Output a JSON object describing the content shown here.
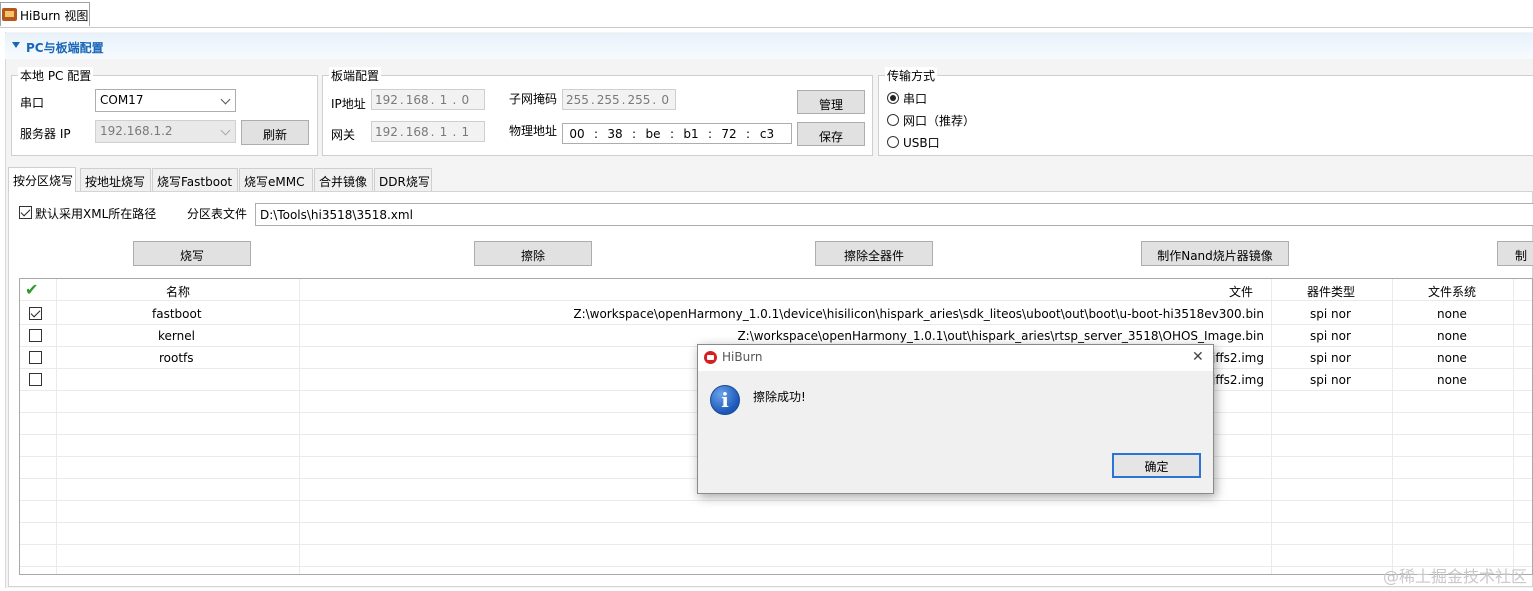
{
  "view_tab": {
    "label": "HiBurn 视图"
  },
  "section": {
    "title": "PC与板端配置"
  },
  "local_pc": {
    "title": "本地 PC 配置",
    "serial_label": "串口",
    "serial_value": "COM17",
    "server_ip_label": "服务器 IP",
    "server_ip_value": "192.168.1.2",
    "refresh_button": "刷新"
  },
  "board": {
    "title": "板端配置",
    "ip_label": "IP地址",
    "ip_value": [
      "192",
      "168",
      "1",
      "0"
    ],
    "gateway_label": "网关",
    "gateway_value": [
      "192",
      "168",
      "1",
      "1"
    ],
    "mask_label": "子网掩码",
    "mask_value": [
      "255",
      "255",
      "255",
      "0"
    ],
    "mac_label": "物理地址",
    "mac_value": [
      "00",
      "38",
      "be",
      "b1",
      "72",
      "c3"
    ],
    "manage_button": "管理",
    "save_button": "保存"
  },
  "transfer": {
    "title": "传输方式",
    "options": [
      {
        "label": "串口",
        "selected": true
      },
      {
        "label": "网口（推荐）",
        "selected": false
      },
      {
        "label": "USB口",
        "selected": false
      }
    ]
  },
  "tabs": [
    "按分区烧写",
    "按地址烧写",
    "烧写Fastboot",
    "烧写eMMC",
    "合并镜像",
    "DDR烧写"
  ],
  "partition": {
    "default_xml_label": "默认采用XML所在路径",
    "default_xml_checked": true,
    "table_file_label": "分区表文件",
    "table_file_value": "D:\\Tools\\hi3518\\3518.xml"
  },
  "actions": [
    "烧写",
    "擦除",
    "擦除全器件",
    "制作Nand烧片器镜像",
    "制作"
  ],
  "table": {
    "headers": {
      "check": "✔",
      "name": "名称",
      "file": "文件",
      "device_type": "器件类型",
      "fs": "文件系统"
    },
    "rows": [
      {
        "checked": true,
        "name": "fastboot",
        "file": "Z:\\workspace\\openHarmony_1.0.1\\device\\hisilicon\\hispark_aries\\sdk_liteos\\uboot\\out\\boot\\u-boot-hi3518ev300.bin",
        "device_type": "spi nor",
        "fs": "none"
      },
      {
        "checked": false,
        "name": "kernel",
        "file": "Z:\\workspace\\openHarmony_1.0.1\\out\\hispark_aries\\rtsp_server_3518\\OHOS_Image.bin",
        "device_type": "spi nor",
        "fs": "none"
      },
      {
        "checked": false,
        "name": "rootfs",
        "file": "jffs2.img",
        "device_type": "spi nor",
        "fs": "none"
      },
      {
        "checked": false,
        "name": "",
        "file": "jffs2.img",
        "device_type": "spi nor",
        "fs": "none"
      }
    ]
  },
  "dialog": {
    "title": "HiBurn",
    "message": "擦除成功!",
    "ok_button": "确定",
    "close_glyph": "✕"
  },
  "watermark": "@稀土掘金技术社区"
}
